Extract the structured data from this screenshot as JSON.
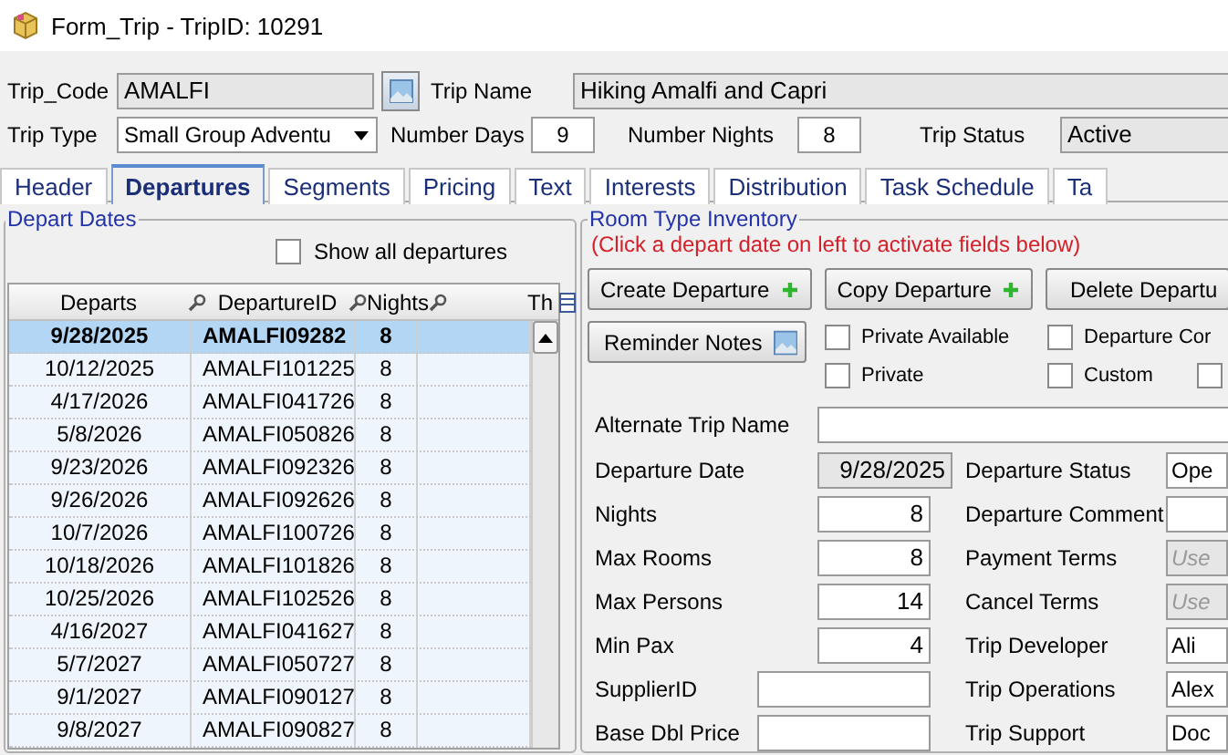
{
  "window": {
    "title": "Form_Trip - TripID: 10291"
  },
  "header": {
    "trip_code": {
      "label": "Trip_Code",
      "value": "AMALFI"
    },
    "trip_name": {
      "label": "Trip Name",
      "value": "Hiking Amalfi and Capri"
    },
    "trip_type": {
      "label": "Trip Type",
      "value": "Small Group Adventu"
    },
    "number_days": {
      "label": "Number Days",
      "value": "9"
    },
    "number_nights": {
      "label": "Number Nights",
      "value": "8"
    },
    "trip_status": {
      "label": "Trip Status",
      "value": "Active"
    }
  },
  "tabs": [
    {
      "label": "Header",
      "selected": false
    },
    {
      "label": "Departures",
      "selected": true
    },
    {
      "label": "Segments",
      "selected": false
    },
    {
      "label": "Pricing",
      "selected": false
    },
    {
      "label": "Text",
      "selected": false
    },
    {
      "label": "Interests",
      "selected": false
    },
    {
      "label": "Distribution",
      "selected": false
    },
    {
      "label": "Task Schedule",
      "selected": false
    },
    {
      "label": "Ta",
      "selected": false
    }
  ],
  "depart_dates": {
    "legend": "Depart Dates",
    "show_all": {
      "label": "Show all departures",
      "checked": false
    },
    "columns": [
      "Departs",
      "DepartureID",
      "Nights",
      "Th"
    ],
    "rows": [
      {
        "departs": "9/28/2025",
        "departure_id": "AMALFI09282",
        "nights": "8",
        "selected": true
      },
      {
        "departs": "10/12/2025",
        "departure_id": "AMALFI101225",
        "nights": "8",
        "selected": false
      },
      {
        "departs": "4/17/2026",
        "departure_id": "AMALFI041726",
        "nights": "8",
        "selected": false
      },
      {
        "departs": "5/8/2026",
        "departure_id": "AMALFI050826",
        "nights": "8",
        "selected": false
      },
      {
        "departs": "9/23/2026",
        "departure_id": "AMALFI092326",
        "nights": "8",
        "selected": false
      },
      {
        "departs": "9/26/2026",
        "departure_id": "AMALFI092626",
        "nights": "8",
        "selected": false
      },
      {
        "departs": "10/7/2026",
        "departure_id": "AMALFI100726",
        "nights": "8",
        "selected": false
      },
      {
        "departs": "10/18/2026",
        "departure_id": "AMALFI101826",
        "nights": "8",
        "selected": false
      },
      {
        "departs": "10/25/2026",
        "departure_id": "AMALFI102526",
        "nights": "8",
        "selected": false
      },
      {
        "departs": "4/16/2027",
        "departure_id": "AMALFI041627",
        "nights": "8",
        "selected": false
      },
      {
        "departs": "5/7/2027",
        "departure_id": "AMALFI050727",
        "nights": "8",
        "selected": false
      },
      {
        "departs": "9/1/2027",
        "departure_id": "AMALFI090127",
        "nights": "8",
        "selected": false
      },
      {
        "departs": "9/8/2027",
        "departure_id": "AMALFI090827",
        "nights": "8",
        "selected": false
      }
    ]
  },
  "room_type_inventory": {
    "legend": "Room Type Inventory",
    "notice": "(Click a depart date  on left to activate fields below)",
    "buttons": [
      {
        "label": "Create Departure",
        "kind": "add"
      },
      {
        "label": "Copy Departure",
        "kind": "add"
      },
      {
        "label": "Delete Departu",
        "kind": "plain"
      }
    ],
    "reminder_button": "Reminder Notes",
    "checkbox_rows": [
      [
        {
          "label": "Private Available",
          "checked": false
        },
        {
          "label": "Departure Cor",
          "checked": false
        }
      ],
      [
        {
          "label": "Private",
          "checked": false
        },
        {
          "label": "Custom",
          "checked": false
        },
        {
          "checked": false
        }
      ]
    ],
    "alternate_trip_name": {
      "label": "Alternate Trip Name"
    },
    "left_fields": [
      {
        "label": "Departure Date",
        "value": "9/28/2025",
        "kind": "number",
        "disabled": true
      },
      {
        "label": "Nights",
        "value": "8",
        "kind": "number",
        "disabled": false
      },
      {
        "label": "Max Rooms",
        "value": "8",
        "kind": "number",
        "disabled": false
      },
      {
        "label": "Max Persons",
        "value": "14",
        "kind": "number",
        "disabled": false
      },
      {
        "label": "Min Pax",
        "value": "4",
        "kind": "number",
        "disabled": false
      },
      {
        "label": "SupplierID",
        "kind": "wide",
        "disabled": false
      },
      {
        "label": "Base Dbl Price",
        "kind": "wide",
        "disabled": false
      }
    ],
    "right_fields": [
      {
        "label": "Departure Status",
        "value": "Ope",
        "disabled": false
      },
      {
        "label": "Departure Comment",
        "disabled": false
      },
      {
        "label": "Payment Terms",
        "placeholder": "Use",
        "disabled": true
      },
      {
        "label": "Cancel Terms",
        "placeholder": "Use",
        "disabled": true
      },
      {
        "label": "Trip Developer",
        "value": "Ali",
        "disabled": false
      },
      {
        "label": "Trip Operations",
        "value": "Alex",
        "disabled": false
      },
      {
        "label": "Trip Support",
        "value": "Doc",
        "disabled": false
      }
    ]
  }
}
